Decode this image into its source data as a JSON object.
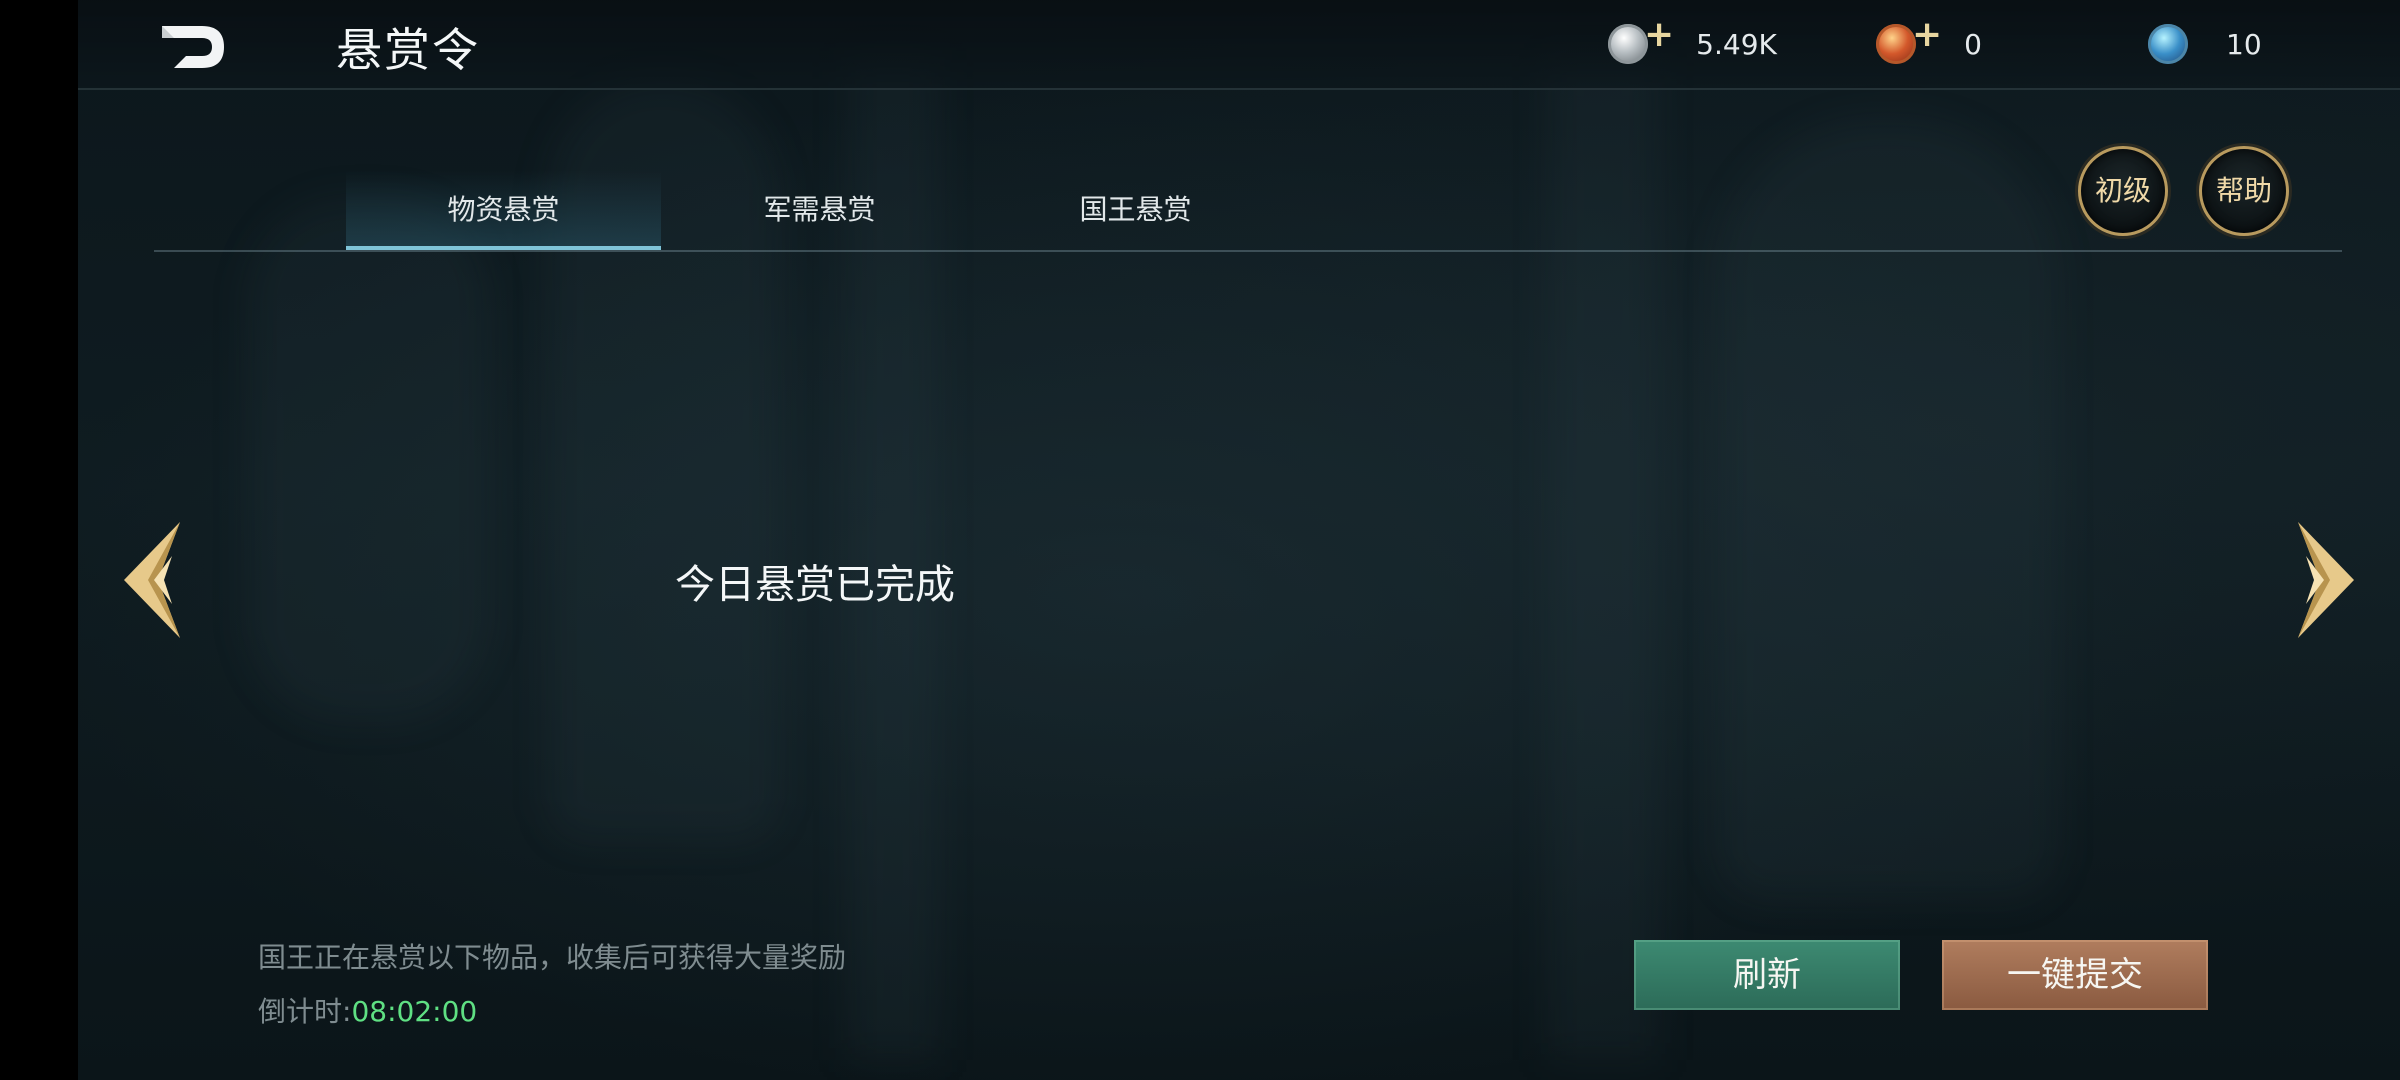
{
  "header": {
    "title": "悬赏令",
    "back_icon": "back-arrow-icon"
  },
  "resources": {
    "silver": {
      "icon": "silver-coin-icon",
      "value": "5.49K",
      "has_plus": true
    },
    "gold": {
      "icon": "gold-token-icon",
      "value": "0",
      "has_plus": true
    },
    "gem": {
      "icon": "gem-orb-icon",
      "value": "10",
      "has_plus": false
    }
  },
  "tabs": [
    {
      "label": "物资悬赏",
      "active": true
    },
    {
      "label": "军需悬赏",
      "active": false
    },
    {
      "label": "国王悬赏",
      "active": false
    }
  ],
  "buttons": {
    "level_label": "初级",
    "help_label": "帮助",
    "refresh_label": "刷新",
    "submit_label": "一键提交"
  },
  "main": {
    "message": "今日悬赏已完成"
  },
  "footer": {
    "hint": "国王正在悬赏以下物品，收集后可获得大量奖励",
    "countdown_label": "倒计时:",
    "countdown_value": "08:02:00"
  },
  "colors": {
    "accent_gold": "#e7c98a",
    "countdown_green": "#5fe083",
    "refresh_green": "#3d8a72",
    "submit_brown": "#b07d5e"
  }
}
